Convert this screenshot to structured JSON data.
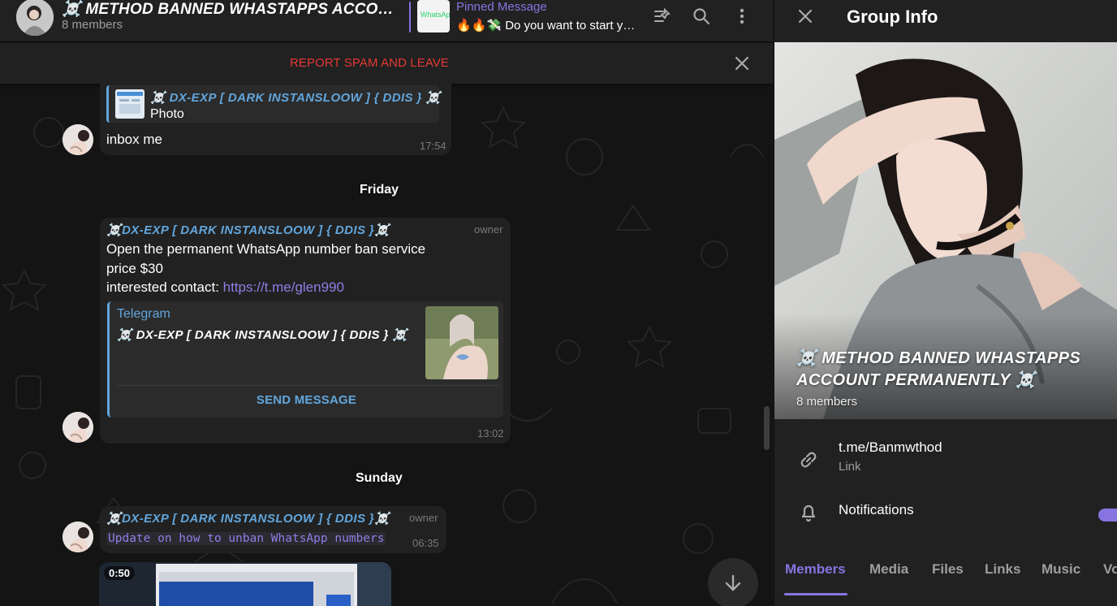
{
  "chat_header": {
    "title": "☠️ METHOD BANNED WHASTAPPS ACCOUNT PERMANENTLY ☠️",
    "subtitle": "8 members"
  },
  "pinned": {
    "label": "Pinned Message",
    "thumb_text": "WhatsApp",
    "text": "🔥🔥💸 Do you want to start your own business"
  },
  "spam_bar": {
    "label": "REPORT SPAM AND LEAVE"
  },
  "messages": [
    {
      "reply_name": "☠️ DX-EXP [ DARK INSTANSLOOW ] { DDIS } ☠️",
      "reply_type": "Photo",
      "text": "inbox me",
      "time": "17:54"
    },
    {
      "sender": "☠️DX-EXP [ DARK INSTANSLOOW ] { DDIS }☠️",
      "role": "owner",
      "line1": "Open the permanent WhatsApp number ban service",
      "line2": "price $30",
      "line3_prefix": "interested contact: ",
      "link": "https://t.me/glen990",
      "webpage_site": "Telegram",
      "webpage_title": "☠️ DX-EXP [ DARK INSTANSLOOW ] { DDIS } ☠️",
      "webpage_button": "SEND MESSAGE",
      "time": "13:02"
    },
    {
      "sender": "☠️DX-EXP [ DARK INSTANSLOOW ] { DDIS }☠️",
      "role": "owner",
      "text": "Update on how to unban WhatsApp numbers",
      "time": "06:35"
    }
  ],
  "dates": [
    "Friday",
    "Sunday"
  ],
  "video": {
    "duration": "0:50"
  },
  "panel": {
    "title": "Group Info",
    "group_name": "☠️ METHOD BANNED WHASTAPPS ACCOUNT PERMANENTLY ☠️",
    "members": "8 members",
    "link": "t.me/Banmwthod",
    "link_label": "Link",
    "notifications": "Notifications",
    "notifications_on": true,
    "tabs": [
      "Members",
      "Media",
      "Files",
      "Links",
      "Music",
      "Voice"
    ]
  },
  "colors": {
    "accent": "#8774e1",
    "link_name": "#62a6dc",
    "danger": "#e53935",
    "bubble": "#212121"
  }
}
